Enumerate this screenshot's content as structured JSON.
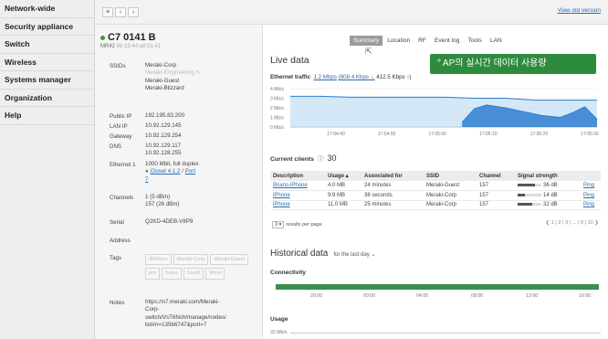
{
  "nav": {
    "items": [
      "Network-wide",
      "Security appliance",
      "Switch",
      "Wireless",
      "Systems manager",
      "Organization",
      "Help"
    ]
  },
  "topbar": {
    "view_old": "View old version"
  },
  "device": {
    "name": "C7 0141 B",
    "model": "MR42",
    "mac": "88:15:44:a8:01:41",
    "ssids_label": "SSIDs",
    "ssids": [
      "Meraki-Corp",
      "Meraki-Engineering",
      "Meraki-Guest",
      "Meraki-Blizzard"
    ],
    "public_ip_label": "Public IP",
    "public_ip": "192.195.83.200",
    "lan_ip_label": "LAN IP",
    "lan_ip": "10.92.129.145",
    "gateway_label": "Gateway",
    "gateway": "10.92.129.254",
    "dns_label": "DNS",
    "dns1": "10.92.129.117",
    "dns2": "10.92.128.255",
    "eth_label": "Ethernet 1",
    "eth_speed": "1000 Mbit, full duplex",
    "eth_link_a": "Closet 4.1.2",
    "eth_sep": " / ",
    "eth_link_b": "Port",
    "eth_port": "7",
    "channels_label": "Channels",
    "channel1": "1 (5 dBm)",
    "channel2": "157 (26 dBm)",
    "serial_label": "Serial",
    "serial": "Q2KD-4DEB-V8P9",
    "address_label": "Address",
    "tags_label": "Tags",
    "tags": [
      "4thFloor",
      "Meraki-Corp",
      "Meraki-Guest",
      "pm",
      "Sales",
      "South",
      "West"
    ],
    "notes_label": "Notes",
    "notes": [
      "https://n7.meraki.com/Meraki-",
      "Corp-",
      "switch/VsT6Nch/manage/nodes/",
      "list#n=13566747&port=7"
    ]
  },
  "tabs": [
    "Summary",
    "Location",
    "RF",
    "Event log",
    "Tools",
    "LAN"
  ],
  "active_tab": "Summary",
  "live": {
    "title": "Live data",
    "traffic_label": "Ethernet traffic",
    "traffic_total": "1.2 Mbps",
    "traffic_down": "(808.4 Kbps ↓,",
    "traffic_up": "412.5 Kbps ↑)",
    "banner": "AP의 실시간 데이터 사용량",
    "banner_mark": "»"
  },
  "chart_data": {
    "type": "area",
    "y_tick_labels": [
      "4 Mb/s",
      "3 Mb/s",
      "2 Mb/s",
      "1 Mb/s",
      "0 Mb/s"
    ],
    "ylim": [
      0,
      4
    ],
    "x_tick_labels": [
      "17:04:40",
      "17:04:50",
      "17:05:00",
      "17:05:10",
      "17:05:20",
      "17:05:30"
    ],
    "series": [
      {
        "x": [
          0,
          5,
          10,
          15,
          20,
          25,
          30,
          35,
          40,
          45,
          50
        ],
        "values": [
          3.2,
          3.2,
          3.1,
          3.1,
          3.1,
          3.1,
          3.0,
          3.0,
          2.8,
          2.8,
          2.8
        ]
      },
      {
        "x": [
          28,
          30,
          32,
          35,
          38,
          41,
          44,
          46,
          48,
          50
        ],
        "values": [
          0.5,
          1.9,
          2.3,
          2.0,
          1.6,
          1.2,
          1.0,
          1.5,
          2.1,
          0.8
        ]
      }
    ],
    "grid": true
  },
  "clients": {
    "label": "Current clients",
    "icon": "ⓘ",
    "count": "30",
    "headers": [
      "Description",
      "Usage ▴",
      "Associated for",
      "SSID",
      "Channel",
      "Signal strength",
      ""
    ],
    "rows": [
      {
        "desc": "Brians-iPhone",
        "usage": "4.0 MB",
        "assoc": "24 minutes",
        "ssid": "Meraki-Guest",
        "channel": "157",
        "signal": "36 dB",
        "signal_level": 0.72,
        "action": "Ping"
      },
      {
        "desc": "iPhone",
        "usage": "9.9 MB",
        "assoc": "38 seconds",
        "ssid": "Meraki-Corp",
        "channel": "157",
        "signal": "14 dB",
        "signal_level": 0.3,
        "action": "Ping"
      },
      {
        "desc": "iPhone",
        "usage": "11.0 MB",
        "assoc": "25 minutes",
        "ssid": "Meraki-Corp",
        "channel": "157",
        "signal": "32 dB",
        "signal_level": 0.62,
        "action": "Ping"
      }
    ],
    "per_page_value": "3",
    "per_page_label": "results per page",
    "pager": "❮ 1 | 2 | 3 | ... | 9 | 10 ❯"
  },
  "historical": {
    "title": "Historical data",
    "range": "for the last day ⌄",
    "connectivity_label": "Connectivity",
    "conn_ticks": [
      "20:00",
      "00:00",
      "04:00",
      "08:00",
      "12:00",
      "16:00"
    ],
    "usage_label": "Usage",
    "usage_top": "32 Mb/s"
  },
  "colors": {
    "accent_green": "#2e8b3e",
    "link_blue": "#2b6cb0",
    "chart_blue": "#2f7fd0",
    "chart_fill": "#b8d8f2"
  }
}
